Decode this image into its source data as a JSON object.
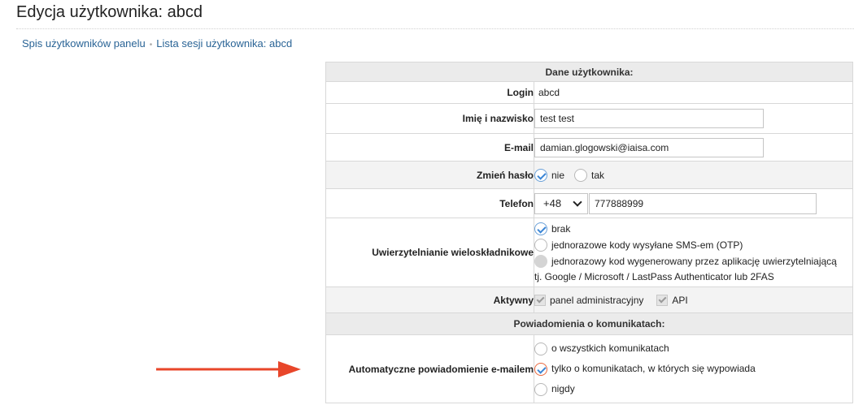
{
  "page": {
    "title": "Edycja użytkownika: abcd"
  },
  "breadcrumb": {
    "items": [
      "Spis użytkowników panelu",
      "Lista sesji użytkownika: abcd"
    ],
    "separator": "•"
  },
  "section_user": "Dane użytkownika:",
  "fields": {
    "login": {
      "label": "Login",
      "value": "abcd"
    },
    "name": {
      "label": "Imię i nazwisko",
      "value": "test test"
    },
    "email": {
      "label": "E-mail",
      "value": "damian.glogowski@iaisa.com"
    },
    "change_password": {
      "label": "Zmień hasło",
      "options": [
        "nie",
        "tak"
      ],
      "selected": "nie"
    },
    "phone": {
      "label": "Telefon",
      "country_code": "+48",
      "number": "777888999"
    },
    "mfa": {
      "label": "Uwierzytelnianie wieloskładnikowe",
      "options": [
        "brak",
        "jednorazowe kody wysyłane SMS-em (OTP)",
        "jednorazowy kod wygenerowany przez aplikację uwierzytelniającą"
      ],
      "note": "tj. Google / Microsoft / LastPass Authenticator lub 2FAS",
      "selected": "brak"
    },
    "active": {
      "label": "Aktywny",
      "options": [
        "panel administracyjny",
        "API"
      ],
      "checked": [
        "panel administracyjny",
        "API"
      ]
    }
  },
  "section_notifications": "Powiadomienia o komunikatach:",
  "notifications": {
    "label": "Automatyczne powiadomienie e-mailem",
    "options": [
      "o wszystkich komunikatach",
      "tylko o komunikatach, w których się wypowiada",
      "nigdy"
    ],
    "selected": "tylko o komunikatach, w których się wypowiada"
  },
  "colors": {
    "arrow": "#e8462a",
    "link": "#2a6496",
    "checkmark": "#3b86d6"
  },
  "icons": [
    "check-icon",
    "chevron-down-icon",
    "arrow-right-icon"
  ]
}
